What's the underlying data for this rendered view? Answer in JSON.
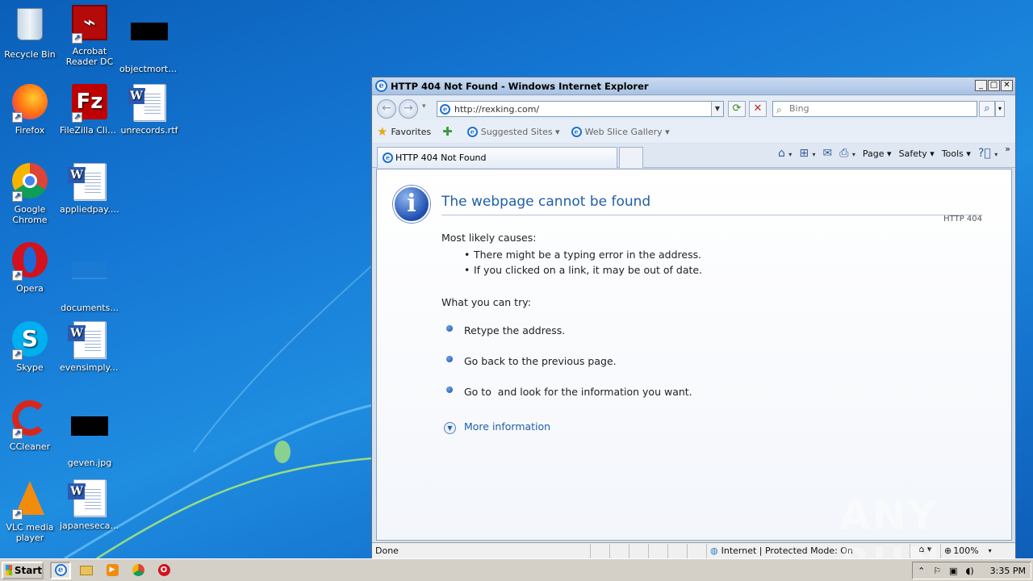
{
  "desktop": {
    "icons": [
      {
        "label": "Recycle Bin"
      },
      {
        "label": "Acrobat Reader DC"
      },
      {
        "label": "objectmortg..."
      },
      {
        "label": "Firefox"
      },
      {
        "label": "FileZilla Client"
      },
      {
        "label": "unrecords.rtf"
      },
      {
        "label": "Google Chrome"
      },
      {
        "label": "appliedpay.rtf"
      },
      {
        "label": "Opera"
      },
      {
        "label": "documents..."
      },
      {
        "label": "Skype"
      },
      {
        "label": "evensimply.rtf"
      },
      {
        "label": "CCleaner"
      },
      {
        "label": "geven.jpg"
      },
      {
        "label": "VLC media player"
      },
      {
        "label": "japanesecar..."
      }
    ]
  },
  "ie": {
    "window_title": "HTTP 404 Not Found - Windows Internet Explorer",
    "address": "http://rexking.com/",
    "search_placeholder": "Bing",
    "favorites_label": "Favorites",
    "suggested_sites": "Suggested Sites",
    "web_slice_gallery": "Web Slice Gallery",
    "tab_title": "HTTP 404 Not Found",
    "menu": {
      "page": "Page",
      "safety": "Safety",
      "tools": "Tools"
    },
    "content": {
      "title": "The webpage cannot be found",
      "http_code": "HTTP 404",
      "causes_heading": "Most likely causes:",
      "causes": [
        "There might be a typing error in the address.",
        "If you clicked on a link, it may be out of date."
      ],
      "try_heading": "What you can try:",
      "try_items": [
        "Retype the address.",
        "Go back to the previous page.",
        "Go to  and look for the information you want."
      ],
      "more_info": "More information"
    },
    "status": {
      "left": "Done",
      "zone": "Internet | Protected Mode: On",
      "zoom": "100%"
    }
  },
  "watermark": "ANY RUN",
  "taskbar": {
    "start_label": "Start",
    "clock": "3:35 PM"
  }
}
